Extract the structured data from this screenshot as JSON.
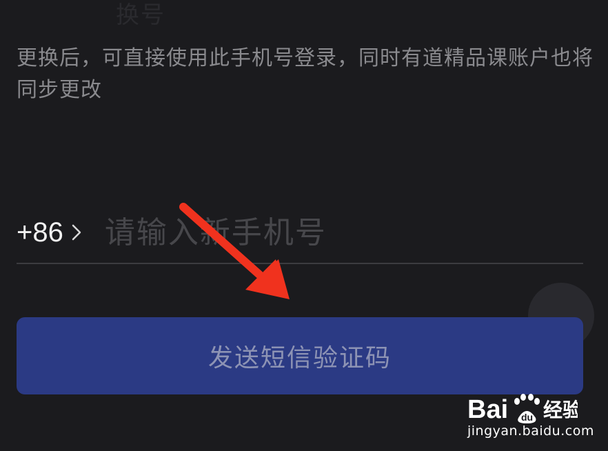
{
  "top_partial_text": "换号",
  "description": "更换后，可直接使用此手机号登录，同时有道精品课账户也将同步更改",
  "phone": {
    "country_code": "+86",
    "placeholder": "请输入新手机号",
    "value": ""
  },
  "submit_label": "发送短信验证码",
  "watermark": {
    "logo_text": "Bai 经验",
    "url": "jingyan.baidu.com"
  },
  "colors": {
    "background": "#1b1b1e",
    "button": "#2b3a84",
    "arrow": "#f0321e"
  }
}
